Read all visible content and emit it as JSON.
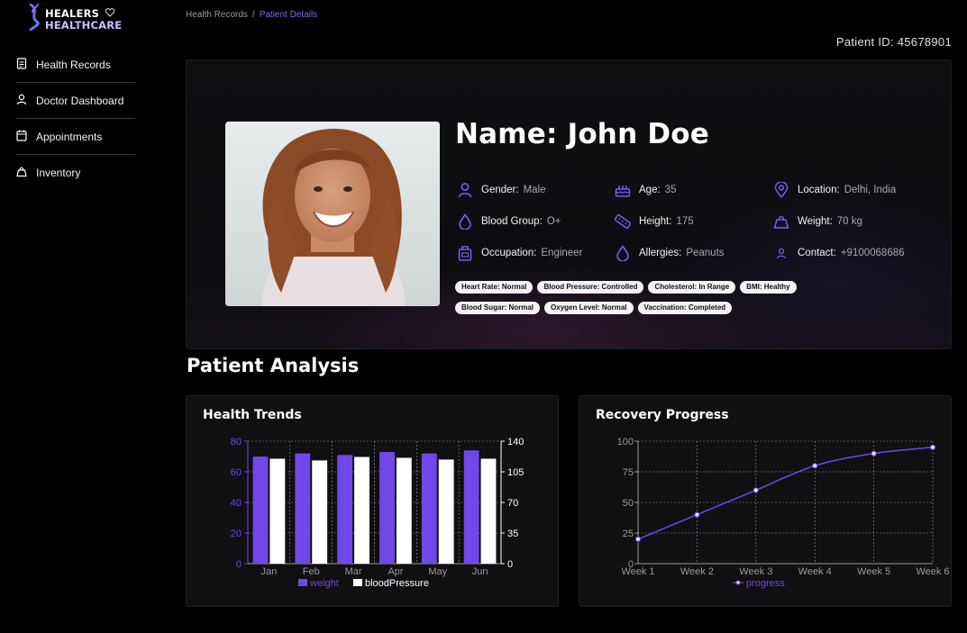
{
  "brand": {
    "line1": "HEALERS",
    "line2": "HEALTHCARE",
    "logo_icon": "dna-icon"
  },
  "sidebar": {
    "items": [
      {
        "label": "Health Records",
        "icon": "document-icon"
      },
      {
        "label": "Doctor Dashboard",
        "icon": "user-icon"
      },
      {
        "label": "Appointments",
        "icon": "calendar-icon"
      },
      {
        "label": "Inventory",
        "icon": "bag-icon"
      }
    ]
  },
  "breadcrumb": {
    "parent": "Health Records",
    "separator": "/",
    "current": "Patient Details"
  },
  "patient_id": "Patient ID: 45678901",
  "patient": {
    "name": "Name: John Doe",
    "fields": {
      "gender": {
        "label": "Gender:",
        "value": "Male",
        "icon": "user-icon"
      },
      "age": {
        "label": "Age:",
        "value": "35",
        "icon": "cake-icon"
      },
      "location": {
        "label": "Location:",
        "value": "Delhi, India",
        "icon": "location-pin-icon"
      },
      "blood_group": {
        "label": "Blood Group:",
        "value": "O+",
        "icon": "drop-icon"
      },
      "height": {
        "label": "Height:",
        "value": "175",
        "icon": "ruler-icon"
      },
      "weight": {
        "label": "Weight:",
        "value": "70 kg",
        "icon": "weight-icon"
      },
      "occupation": {
        "label": "Occupation:",
        "value": "Engineer",
        "icon": "briefcase-icon"
      },
      "allergies": {
        "label": "Allergies:",
        "value": "Peanuts",
        "icon": "drop-icon"
      },
      "contact": {
        "label": "Contact:",
        "value": "+9100068686",
        "icon": "contact-icon"
      }
    },
    "tags": [
      "Heart Rate: Normal",
      "Blood Pressure: Controlled",
      "Cholesterol: In Range",
      "BMI: Healthy",
      "Blood Sugar: Normal",
      "Oxygen Level: Normal",
      "Vaccination: Completed"
    ]
  },
  "analysis": {
    "title": "Patient Analysis"
  },
  "colors": {
    "accent": "#7048e8",
    "accent_text": "#7b6cf0",
    "bar_secondary": "#ffffff",
    "card_bg": "#101012"
  },
  "chart_data": [
    {
      "type": "bar",
      "title": "Health Trends",
      "categories": [
        "Jan",
        "Feb",
        "Mar",
        "Apr",
        "May",
        "Jun"
      ],
      "series": [
        {
          "name": "weight",
          "axis": "left",
          "color": "#7048e8",
          "values": [
            70,
            72,
            71,
            73,
            72,
            74
          ]
        },
        {
          "name": "bloodPressure",
          "axis": "right",
          "color": "#ffffff",
          "values": [
            120,
            118,
            122,
            121,
            119,
            120
          ]
        }
      ],
      "y_left": {
        "ticks": [
          "0",
          "20",
          "40",
          "60",
          "80"
        ],
        "ylim": [
          0,
          80
        ]
      },
      "y_right": {
        "ticks": [
          "0",
          "35",
          "70",
          "105",
          "140"
        ],
        "ylim": [
          0,
          140
        ]
      },
      "grid": true,
      "legend": "bottom"
    },
    {
      "type": "line",
      "title": "Recovery Progress",
      "x": [
        "Week 1",
        "Week 2",
        "Week 3",
        "Week 4",
        "Week 5",
        "Week 6"
      ],
      "series": [
        {
          "name": "progress",
          "color": "#7048e8",
          "values": [
            20,
            40,
            60,
            80,
            90,
            95
          ]
        }
      ],
      "y": {
        "ticks": [
          "0",
          "25",
          "50",
          "75",
          "100"
        ],
        "ylim": [
          0,
          100
        ]
      },
      "grid": true,
      "legend": "bottom"
    }
  ]
}
